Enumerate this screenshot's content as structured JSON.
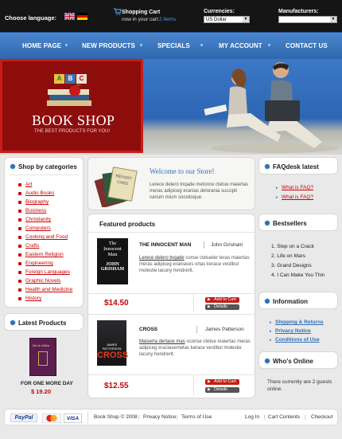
{
  "topbar": {
    "choose_language": "Choose language:",
    "cart_title": "Shopping Cart",
    "cart_now": "now in your cart",
    "cart_items": "2 items",
    "currencies_label": "Currencies:",
    "currency_value": "US Dollar",
    "manufacturers_label": "Manufacturers:",
    "manufacturers_value": ""
  },
  "nav": {
    "items": [
      "HOME PAGE",
      "NEW PRODUCTS",
      "SPECIALS",
      "MY ACCOUNT",
      "CONTACT US"
    ]
  },
  "hero": {
    "abc_blocks": [
      "A",
      "B",
      "C"
    ],
    "title": "BOOK SHOP",
    "subtitle": "THE BEST PRODUCTS FOR YOU!"
  },
  "categories": {
    "title": "Shop by categories",
    "items": [
      "Art",
      "Audio Books",
      "Biography",
      "Business",
      "Christianity",
      "Computers",
      "Cooking and Food",
      "Crafts",
      "Eastern Religion",
      "Engineering",
      "Foreign Languages",
      "Graphic Novels",
      "Health and Medicine",
      "History"
    ]
  },
  "latest_products": {
    "title": "Latest Products",
    "cover_title": "Ma te Affeia",
    "caption": "FOR ONE MORE DAY",
    "price": "$ 19.20"
  },
  "welcome": {
    "title": "Welcome to our Store!",
    "text": "Lerece delero tnqade metonce ctetue maiertas meras adipiceg eranias delorania succipit varium mium sociotoque.",
    "card_lines": [
      "REPORT",
      "CARD"
    ]
  },
  "featured": {
    "title": "Featured products",
    "products": [
      {
        "name": "THE INNOCENT MAN",
        "author": "John Grisham",
        "desc_lead": "Lerece delero tnqade",
        "desc": "conse ctetueler teras maiertas meras adipiceg eraniases ortas kerace vestibul molestie lacuny hendrerit.",
        "price": "$14.50",
        "cover": [
          "The",
          "Innocent",
          "Man",
          "JOHN",
          "GRISHAM"
        ]
      },
      {
        "name": "CROSS",
        "author": "James Patterson",
        "desc_lead": "Maiserta dertase mas",
        "desc": "oconse ctetue maiertas meras adipiceg eraciasemetas kerace vestibul molestie lacuny hendrerit.",
        "price": "$12.55",
        "cover": [
          "JAMES PATTERSON",
          "CROSS"
        ]
      }
    ],
    "add_to_cart": "Add to Cart",
    "details": "Details"
  },
  "faqdesk": {
    "title": "FAQdesk latest",
    "items": [
      "What is FAQ?",
      "What is FAQ?"
    ]
  },
  "bestsellers": {
    "title": "Bestsellers",
    "items": [
      "1. Step on a Crack",
      "2. Life on Mars",
      "3. Grand Designs",
      "4. I Can Make You Thin"
    ]
  },
  "information": {
    "title": "Information",
    "items": [
      "Shipping & Returns",
      "Privacy Notice",
      "Conditions of Use"
    ]
  },
  "whos_online": {
    "title": "Who's Online",
    "text": "There currently are 2 guests online."
  },
  "footer": {
    "paypal": "PayPal",
    "visa": "VISA",
    "copyright": "Book Shop © 2008",
    "privacy": "Privacy Notice",
    "terms": "Terms of Use",
    "login": "Log In",
    "cart_contents": "Cart Contents",
    "checkout": "Checkout"
  },
  "colors": {
    "accent_blue": "#2f6fb9",
    "red": "#c00000",
    "dark": "#151515"
  }
}
